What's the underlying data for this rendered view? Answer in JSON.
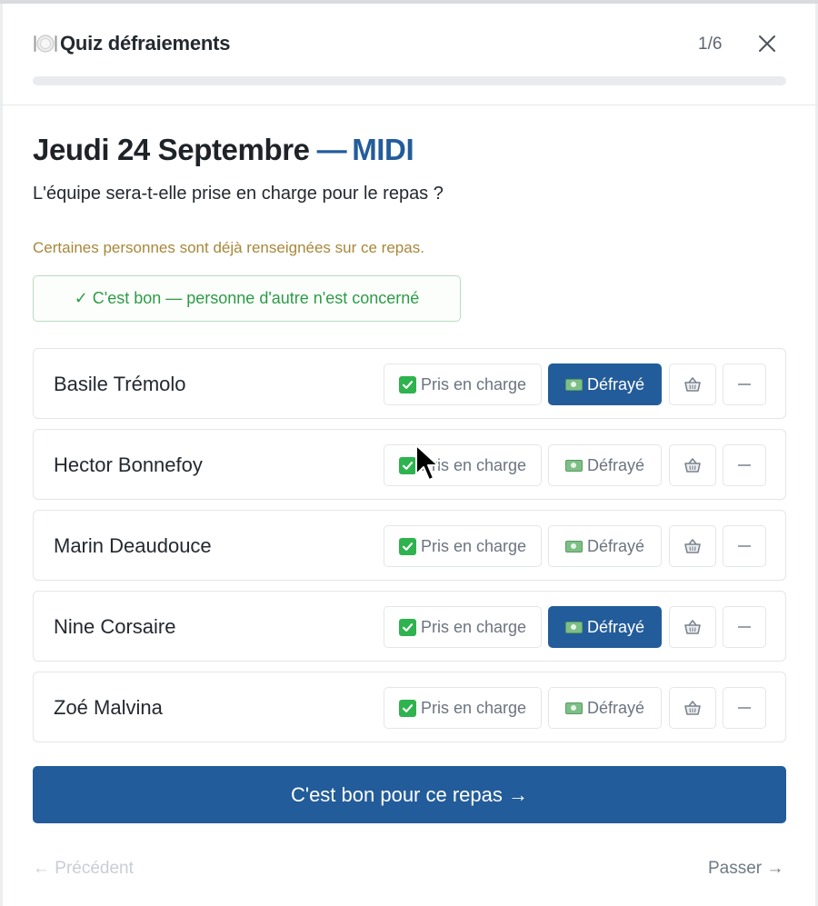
{
  "header": {
    "icon": "plate-cutlery-icon",
    "title": "Quiz défraiements",
    "step": "1/6",
    "close_icon": "close-icon",
    "progress": 0.0
  },
  "meal": {
    "date": "Jeudi 24 Septembre",
    "separator": "—",
    "slot": "MIDI",
    "question": "L'équipe sera-t-elle prise en charge pour le repas ?",
    "notice": "Certaines personnes sont déjà renseignées sur ce repas.",
    "ok_label": "✓ C'est bon — personne d'autre n'est concerné"
  },
  "options": {
    "pris_label": "Pris en charge",
    "defraye_label": "Défrayé",
    "basket_icon": "basket-icon",
    "none_icon": "dash-icon"
  },
  "people": [
    {
      "name": "Basile Trémolo",
      "selected": "defraye"
    },
    {
      "name": "Hector Bonnefoy",
      "selected": ""
    },
    {
      "name": "Marin Deaudouce",
      "selected": ""
    },
    {
      "name": "Nine Corsaire",
      "selected": "defraye"
    },
    {
      "name": "Zoé Malvina",
      "selected": ""
    }
  ],
  "footer": {
    "confirm_label": "C'est bon pour ce repas →",
    "prev_label": "← Précédent",
    "skip_label": "Passer →"
  },
  "colors": {
    "primary": "#235c9a",
    "success": "#2e9b48",
    "notice": "#a8873a"
  }
}
